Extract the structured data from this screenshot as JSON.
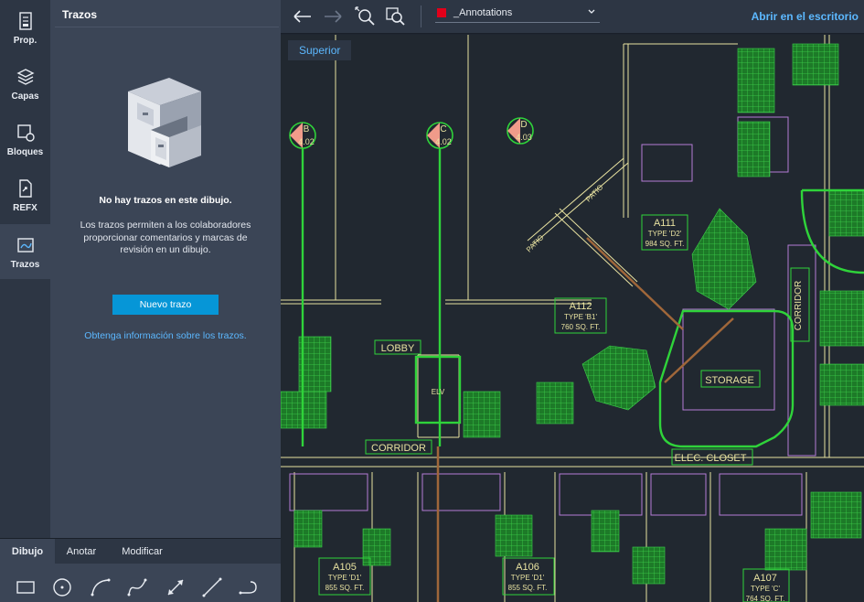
{
  "rail": {
    "items": [
      {
        "label": "Prop.",
        "icon": "properties-icon"
      },
      {
        "label": "Capas",
        "icon": "layers-icon"
      },
      {
        "label": "Bloques",
        "icon": "blocks-icon"
      },
      {
        "label": "REFX",
        "icon": "xref-icon"
      },
      {
        "label": "Trazos",
        "icon": "traces-icon"
      }
    ]
  },
  "panel": {
    "title": "Trazos",
    "empty_title": "No hay trazos en este dibujo.",
    "empty_description": "Los trazos permiten a los colaboradores proporcionar comentarios y marcas de revisión en un dibujo.",
    "new_button": "Nuevo trazo",
    "learn_link": "Obtenga información sobre los trazos."
  },
  "bottom_tabs": [
    "Dibujo",
    "Anotar",
    "Modificar"
  ],
  "bottom_tools": [
    "rectangle-icon",
    "circle-icon",
    "arc-icon",
    "spline-icon",
    "dimension-icon",
    "line-icon",
    "polyline-icon"
  ],
  "toolbar": {
    "layer_name": "_Annotations",
    "layer_color": "#e2001a",
    "open_desktop": "Abrir en el escritorio"
  },
  "canvas": {
    "view_label": "Superior",
    "labels": {
      "grid_b": "B",
      "grid_b_ref": "4.02",
      "grid_c": "C",
      "grid_c_ref": "4.02",
      "grid_d": "D",
      "grid_d_ref": "4.03",
      "patio1": "PATIO",
      "patio2": "PATIO",
      "a111": "A111",
      "a111_type": "TYPE 'D2'",
      "a111_area": "984 SQ. FT.",
      "a112": "A112",
      "a112_type": "TYPE 'B1'",
      "a112_area": "760 SQ. FT.",
      "lobby": "LOBBY",
      "storage": "STORAGE",
      "corridor_v": "CORRIDOR",
      "corridor_h": "CORRIDOR",
      "elec": "ELEC. CLOSET",
      "a105": "A105",
      "a105_type": "TYPE 'D1'",
      "a105_area": "855 SQ. FT.",
      "a106": "A106",
      "a106_type": "TYPE 'D1'",
      "a106_area": "855 SQ. FT.",
      "a107": "A107",
      "a107_type": "TYPE 'C'",
      "a107_area": "764 SQ. FT.",
      "elv": "ELV"
    }
  }
}
